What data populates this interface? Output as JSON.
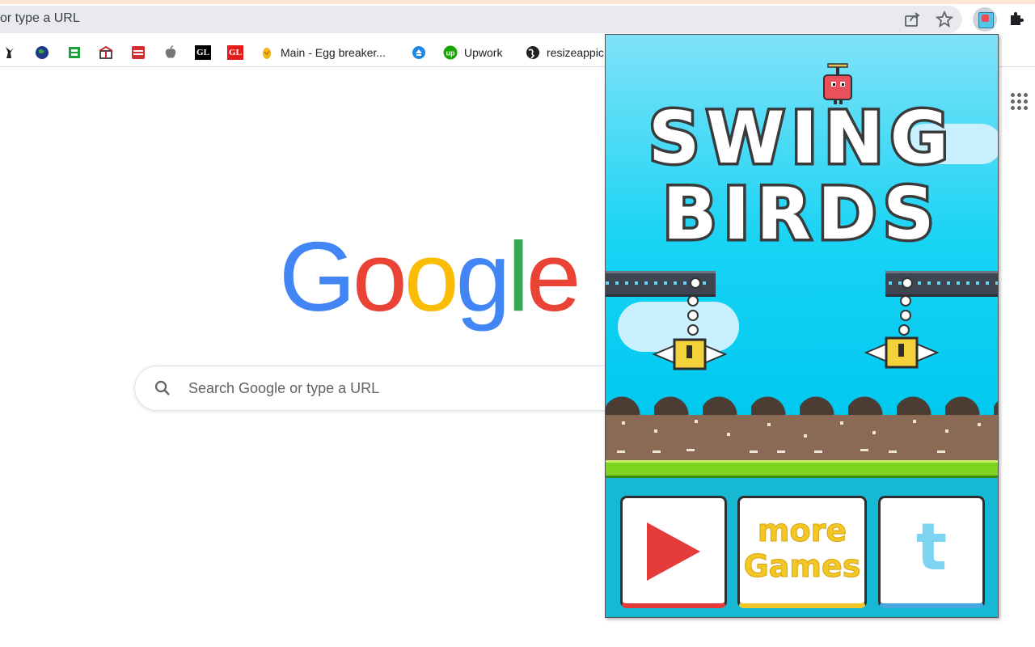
{
  "browser": {
    "omnibox_text": "or type a URL",
    "bookmarks": [
      {
        "icon": "bookmark-hand-icon",
        "label": ""
      },
      {
        "icon": "bookmark-globe-icon",
        "label": ""
      },
      {
        "icon": "bookmark-green-icon",
        "label": ""
      },
      {
        "icon": "bookmark-gift-icon",
        "label": ""
      },
      {
        "icon": "bookmark-holy-bible-icon",
        "label": ""
      },
      {
        "icon": "bookmark-apple-icon",
        "label": ""
      },
      {
        "icon": "bookmark-gl-black-icon",
        "label": ""
      },
      {
        "icon": "bookmark-gl-red-icon",
        "label": ""
      },
      {
        "icon": "bookmark-egg-icon",
        "label": "Main - Egg breaker..."
      },
      {
        "icon": "bookmark-blue-icon",
        "label": ""
      },
      {
        "icon": "upwork-icon",
        "label": "Upwork"
      },
      {
        "icon": "globe-icon",
        "label": "resizeappic"
      }
    ],
    "gl_text": "GL"
  },
  "google": {
    "logo_letters": [
      "G",
      "o",
      "o",
      "g",
      "l",
      "e"
    ],
    "logo_colors": [
      "#4285f4",
      "#ea4335",
      "#fbbc05",
      "#4285f4",
      "#34a853",
      "#ea4335"
    ],
    "search_placeholder": "Search Google or type a URL"
  },
  "game": {
    "title_line1": "SWING",
    "title_line2": "BIRDS",
    "more_games_line1": "more",
    "more_games_line2": "Games",
    "twitter_glyph": "t"
  }
}
